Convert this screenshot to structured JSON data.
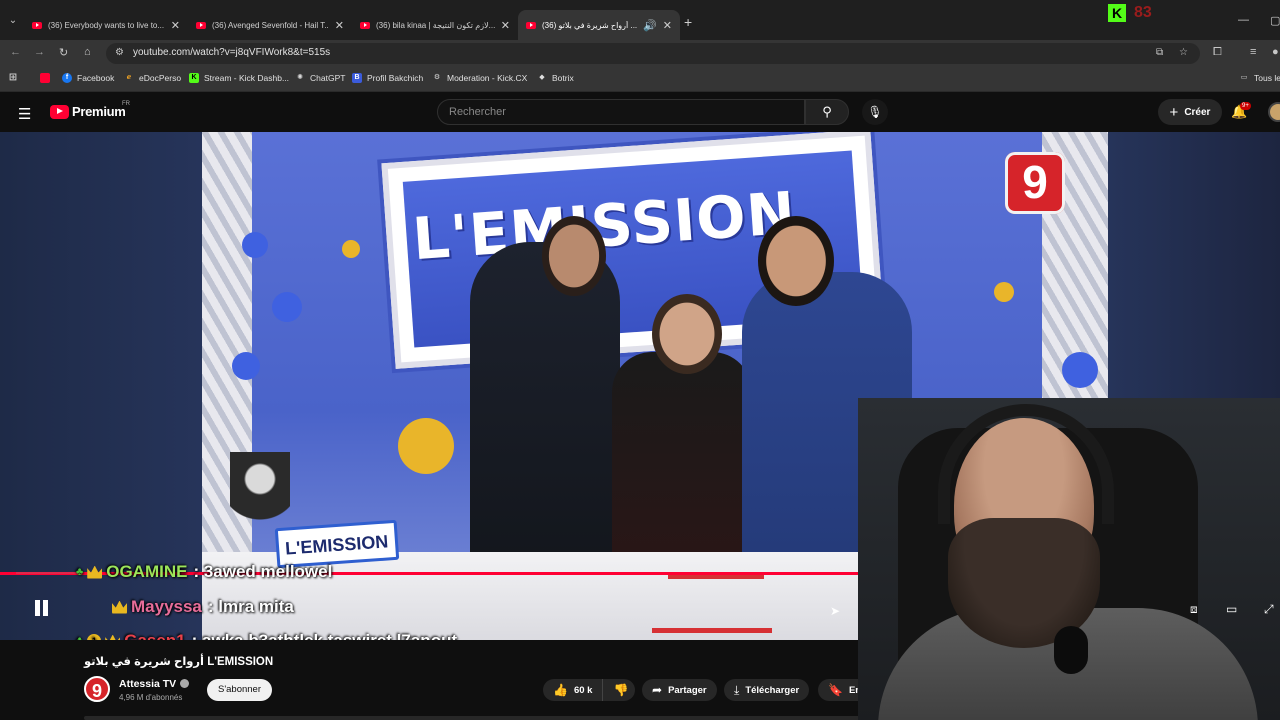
{
  "browser": {
    "tabs": [
      {
        "title": "(36) Everybody wants to live to...",
        "active": false
      },
      {
        "title": "(36) Avenged Sevenfold - Hail T...",
        "active": false
      },
      {
        "title": "(36) bila kinaa | لازم تكون النتيجة...",
        "active": false
      },
      {
        "title": "(36) أرواح شريرة في بلاتو ...",
        "active": true
      }
    ],
    "extension_badge": "83",
    "url": "youtube.com/watch?v=j8qVFIWork8&t=515s",
    "bookmarks": [
      "Facebook",
      "eDocPerso",
      "Stream - Kick Dashb...",
      "ChatGPT",
      "Profil Bakchich",
      "Moderation - Kick.CX",
      "Botrix"
    ],
    "bookmarks_right": "Tous le"
  },
  "youtube": {
    "logo_word": "Premium",
    "country": "FR",
    "search_placeholder": "Rechercher",
    "create_label": "Créer",
    "notif_count": "9+"
  },
  "video": {
    "studio_sign": "L'EMISSION",
    "lower_third": "L'EMISSION",
    "channel_logo": "9",
    "progress_percent": 70,
    "title": "أرواح شريرة في بلاتو L'EMISSION"
  },
  "chat": [
    {
      "user": "OGAMINE",
      "user_color": "#9be55a",
      "message": ": 3awed mellowel",
      "badge": "crown"
    },
    {
      "user": "Mayyssa",
      "user_color": "#e86d9a",
      "message": ": lmra mita",
      "badge": "crown"
    },
    {
      "user": "Gasen1",
      "user_color": "#e8414a",
      "message": ": awka b3athtlek taswiret l7anout",
      "badge": "1"
    }
  ],
  "channel": {
    "name": "Attessia TV",
    "subscribers": "4,96 M d'abonnés",
    "subscribe_label": "S'abonner",
    "avatar_text": "9"
  },
  "actions": {
    "likes": "60 k",
    "share": "Partager",
    "download": "Télécharger",
    "save": "Enr"
  },
  "colors": {
    "youtube_red": "#ff0033",
    "kick_green": "#53fc18",
    "background": "#0f0f0f"
  }
}
